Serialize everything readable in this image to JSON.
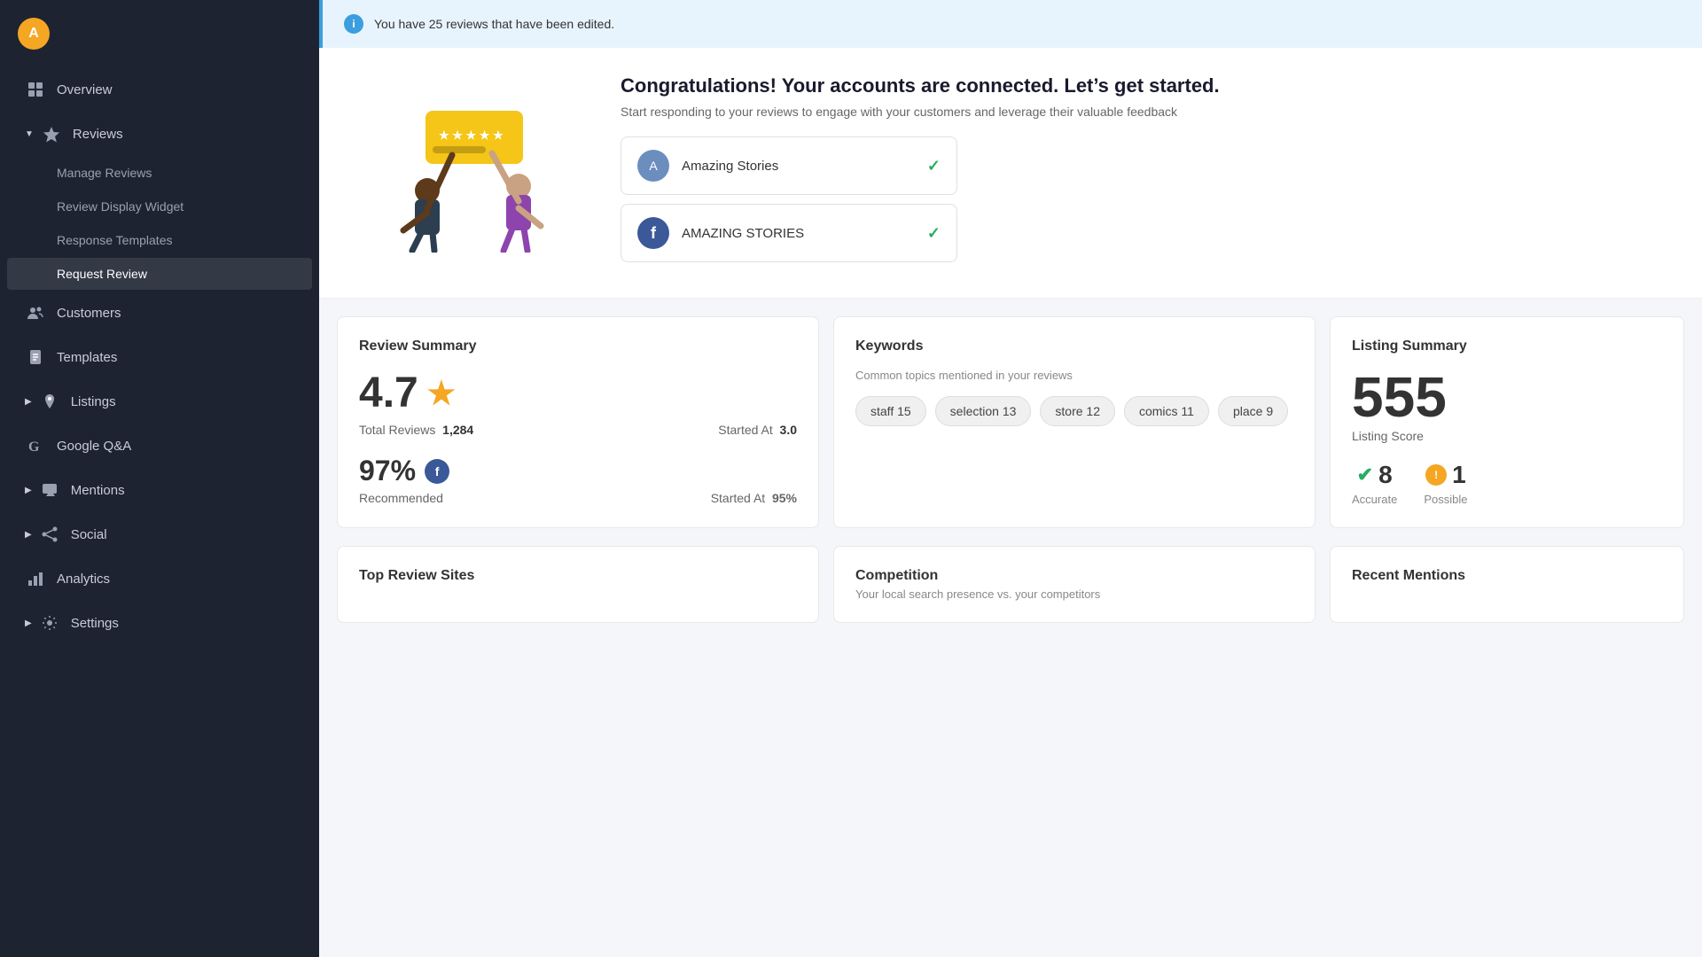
{
  "sidebar": {
    "logo_text": "A",
    "items": [
      {
        "id": "overview",
        "label": "Overview",
        "icon": "grid-icon",
        "has_arrow": false,
        "expanded": false
      },
      {
        "id": "reviews",
        "label": "Reviews",
        "icon": "star-icon",
        "has_arrow": true,
        "expanded": true
      },
      {
        "id": "customers",
        "label": "Customers",
        "icon": "people-icon",
        "has_arrow": false,
        "expanded": false
      },
      {
        "id": "templates",
        "label": "Templates",
        "icon": "doc-icon",
        "has_arrow": false,
        "expanded": false
      },
      {
        "id": "listings",
        "label": "Listings",
        "icon": "pin-icon",
        "has_arrow": true,
        "expanded": false
      },
      {
        "id": "google-qa",
        "label": "Google Q&A",
        "icon": "google-icon",
        "has_arrow": false,
        "expanded": false
      },
      {
        "id": "mentions",
        "label": "Mentions",
        "icon": "chat-icon",
        "has_arrow": true,
        "expanded": false
      },
      {
        "id": "social",
        "label": "Social",
        "icon": "social-icon",
        "has_arrow": true,
        "expanded": false
      },
      {
        "id": "analytics",
        "label": "Analytics",
        "icon": "chart-icon",
        "has_arrow": false,
        "expanded": false
      },
      {
        "id": "settings",
        "label": "Settings",
        "icon": "gear-icon",
        "has_arrow": true,
        "expanded": false
      }
    ],
    "sub_items": [
      {
        "id": "manage-reviews",
        "label": "Manage Reviews"
      },
      {
        "id": "review-display-widget",
        "label": "Review Display Widget"
      },
      {
        "id": "response-templates",
        "label": "Response Templates"
      },
      {
        "id": "request-review",
        "label": "Request Review",
        "active": true
      }
    ]
  },
  "notification": {
    "text": "You have 25 reviews that have been edited."
  },
  "welcome": {
    "title": "Congratulations! Your accounts are connected. Let’s get started.",
    "subtitle": "Start responding to your reviews to engage with your customers and leverage their valuable feedback",
    "accounts": [
      {
        "id": "amazing-stories",
        "name": "Amazing Stories",
        "type": "generic"
      },
      {
        "id": "amazing-stories-fb",
        "name": "AMAZING STORIES",
        "type": "facebook"
      }
    ]
  },
  "review_summary": {
    "title": "Review Summary",
    "rating": "4.7",
    "star": "★",
    "total_reviews_label": "Total Reviews",
    "total_reviews_value": "1,284",
    "started_at_label": "Started At",
    "started_at_value": "3.0",
    "recommended_pct": "97%",
    "recommended_label": "Recommended",
    "started_at_2_label": "Started At",
    "started_at_2_value": "95%"
  },
  "keywords": {
    "title": "Keywords",
    "subtitle": "Common topics mentioned in your reviews",
    "tags": [
      {
        "label": "staff 15"
      },
      {
        "label": "selection 13"
      },
      {
        "label": "store 12"
      },
      {
        "label": "comics 11"
      },
      {
        "label": "place 9"
      }
    ]
  },
  "listing_summary": {
    "title": "Listing Summary",
    "score": "555",
    "score_label": "Listing Score",
    "accurate_count": "8",
    "accurate_label": "Accurate",
    "possible_label": "Possible",
    "possible_count": "1"
  },
  "bottom_cards": [
    {
      "id": "top-review-sites",
      "title": "Top Review Sites",
      "subtitle": ""
    },
    {
      "id": "competition",
      "title": "Competition",
      "subtitle": "Your local search presence vs. your competitors"
    },
    {
      "id": "recent-mentions",
      "title": "Recent Mentions",
      "subtitle": ""
    }
  ]
}
